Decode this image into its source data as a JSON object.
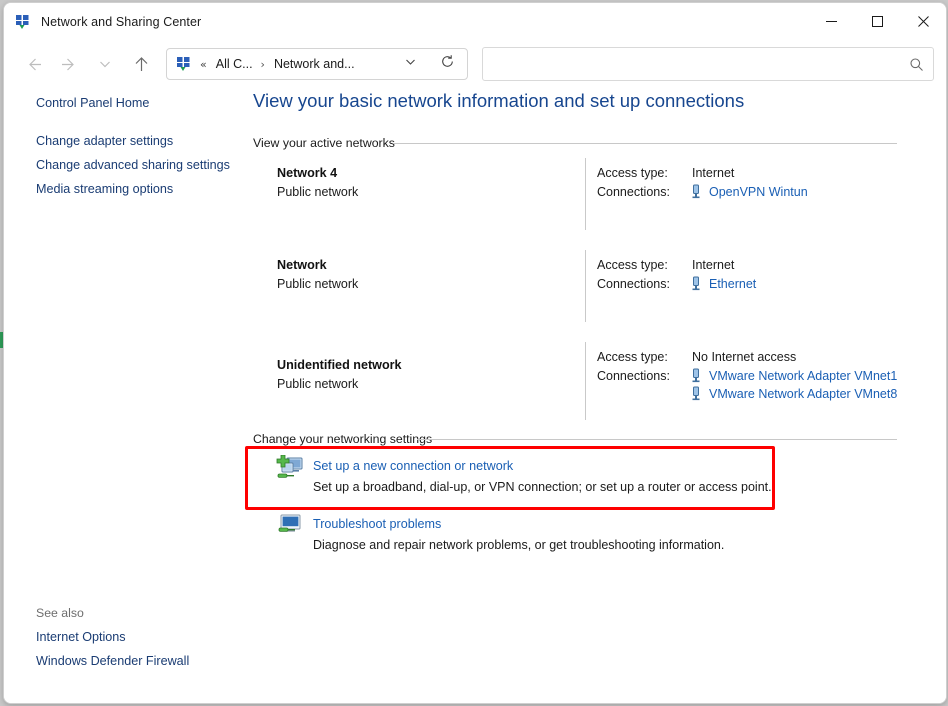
{
  "window": {
    "title": "Network and Sharing Center",
    "title_icon": "network-sharing-icon",
    "minimize_label": "Minimize",
    "maximize_label": "Maximize",
    "close_label": "Close"
  },
  "toolbar": {
    "back_label": "Back",
    "forward_label": "Forward",
    "recent_label": "Recent locations",
    "up_label": "Up",
    "address": {
      "icon": "network-sharing-icon",
      "overflow": "«",
      "segment1": "All C...",
      "separator": "›",
      "segment2": "Network and...",
      "dropdown": "⌄",
      "refresh_label": "Refresh"
    },
    "search": {
      "value": "",
      "placeholder": "",
      "icon": "search-icon"
    }
  },
  "sidebar": {
    "home_link": "Control Panel Home",
    "items": [
      {
        "label": "Change adapter settings"
      },
      {
        "label": "Change advanced sharing settings"
      },
      {
        "label": "Media streaming options"
      }
    ],
    "see_also_label": "See also",
    "see_also": [
      {
        "label": "Internet Options"
      },
      {
        "label": "Windows Defender Firewall"
      }
    ]
  },
  "content": {
    "heading": "View your basic network information and set up connections",
    "active_networks_label": "View your active networks",
    "access_type_label": "Access type:",
    "connections_label": "Connections:",
    "networks": [
      {
        "name": "Network 4",
        "type": "Public network",
        "access_type": "Internet",
        "connections": [
          {
            "label": "OpenVPN Wintun",
            "icon": "network-adapter-icon"
          }
        ]
      },
      {
        "name": "Network",
        "type": "Public network",
        "access_type": "Internet",
        "connections": [
          {
            "label": "Ethernet",
            "icon": "network-adapter-icon"
          }
        ]
      },
      {
        "name": "Unidentified network",
        "type": "Public network",
        "access_type": "No Internet access",
        "connections": [
          {
            "label": "VMware Network Adapter VMnet1",
            "icon": "network-adapter-icon"
          },
          {
            "label": "VMware Network Adapter VMnet8",
            "icon": "network-adapter-icon"
          }
        ]
      }
    ],
    "change_settings_label": "Change your networking settings",
    "tasks": [
      {
        "link": "Set up a new connection or network",
        "description": "Set up a broadband, dial-up, or VPN connection; or set up a router or access point.",
        "icon": "new-connection-icon"
      },
      {
        "link": "Troubleshoot problems",
        "description": "Diagnose and repair network problems, or get troubleshooting information.",
        "icon": "troubleshoot-icon"
      }
    ]
  },
  "annotation": {
    "highlight_color": "#fe0000"
  }
}
